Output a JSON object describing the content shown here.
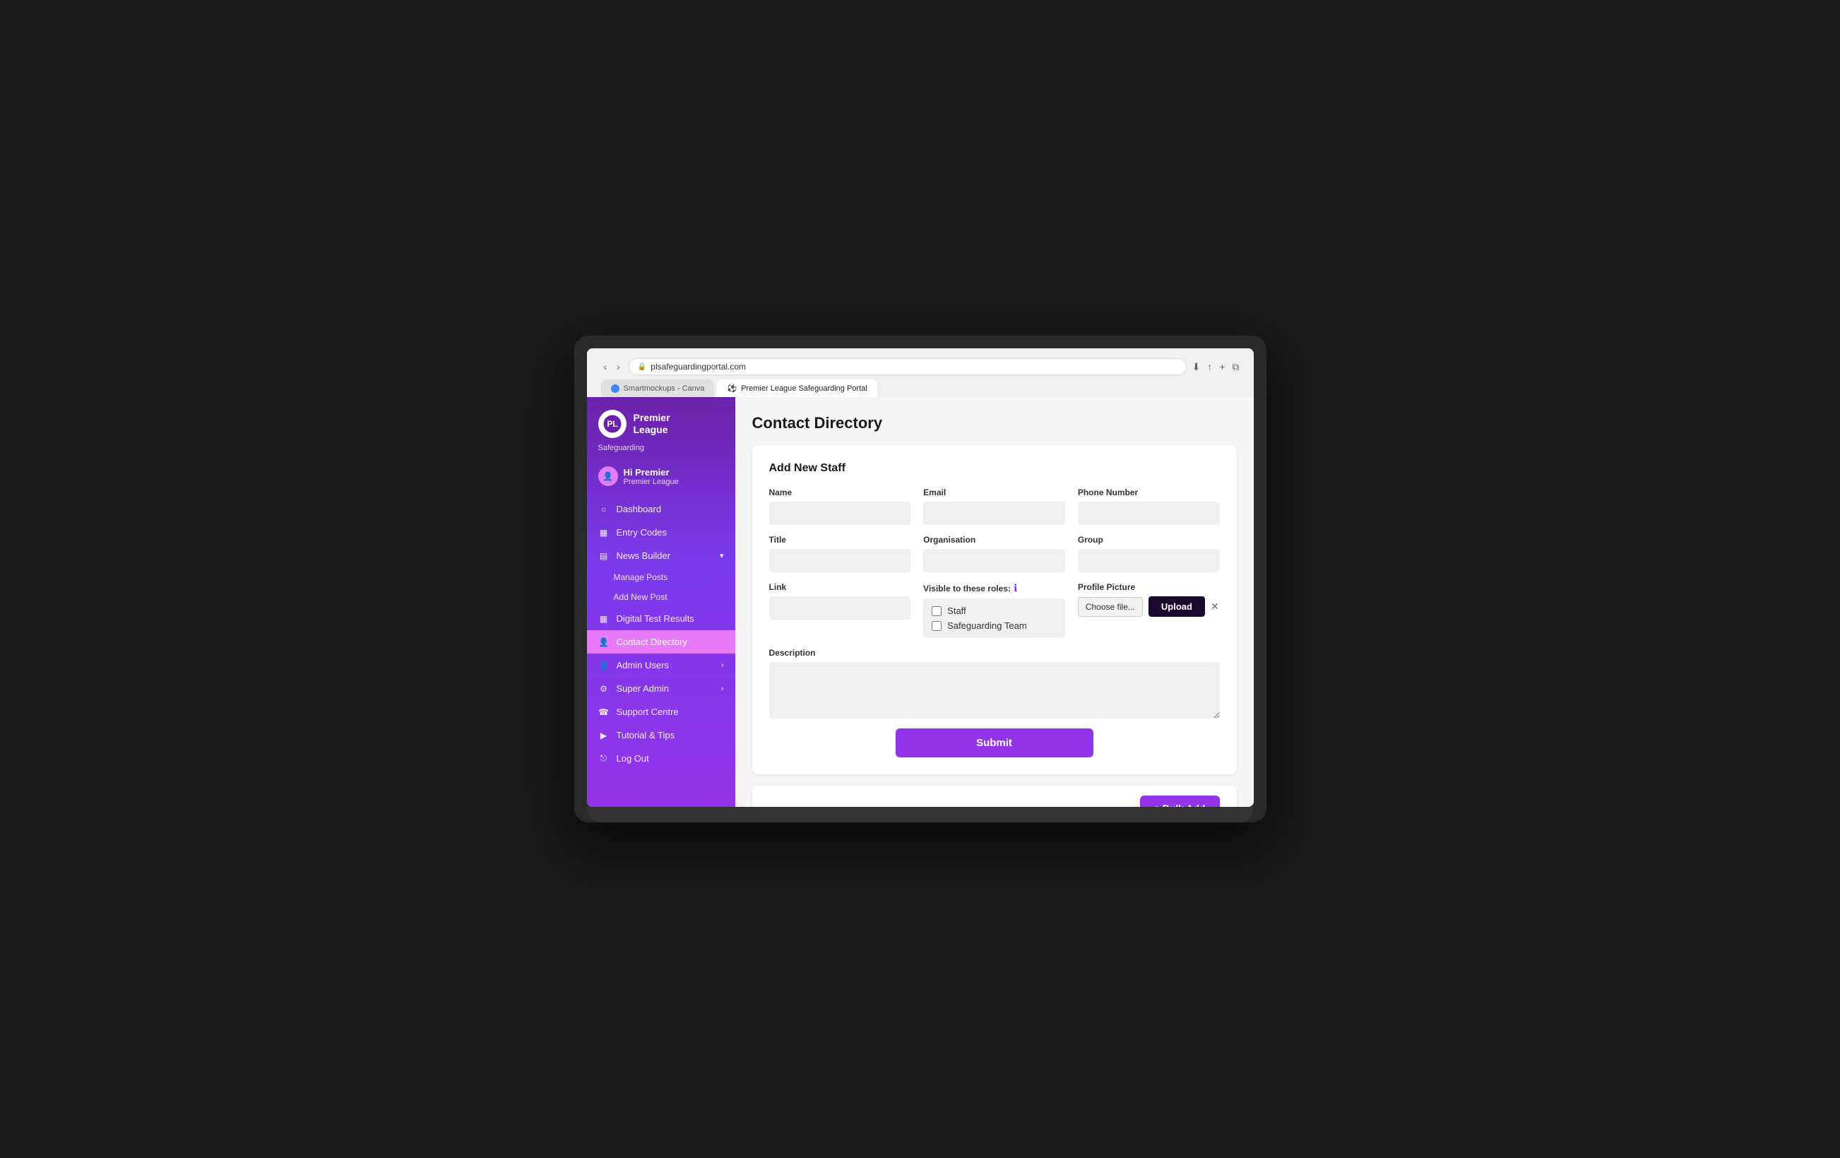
{
  "browser": {
    "url": "plsafeguardingportal.com",
    "tabs": [
      {
        "id": "tab1",
        "label": "Smartmockups - Canva",
        "active": false
      },
      {
        "id": "tab2",
        "label": "Premier League Safeguarding Portal",
        "active": true
      }
    ],
    "back_btn": "‹",
    "forward_btn": "›"
  },
  "sidebar": {
    "logo_text": "Premier\nLeague",
    "logo_sub": "Safeguarding",
    "user_greeting": "Hi Premier",
    "user_name": "Premier League",
    "nav_items": [
      {
        "id": "dashboard",
        "label": "Dashboard",
        "icon": "○",
        "active": false
      },
      {
        "id": "entry-codes",
        "label": "Entry Codes",
        "icon": "▦",
        "active": false
      },
      {
        "id": "news-builder",
        "label": "News Builder",
        "icon": "▤",
        "active": false,
        "has_arrow": true
      },
      {
        "id": "manage-posts",
        "label": "Manage Posts",
        "icon": "",
        "active": false,
        "sub": true
      },
      {
        "id": "add-new-post",
        "label": "Add New Post",
        "icon": "",
        "active": false,
        "sub": true
      },
      {
        "id": "digital-test",
        "label": "Digital Test Results",
        "icon": "▦",
        "active": false
      },
      {
        "id": "contact-directory",
        "label": "Contact Directory",
        "icon": "👤",
        "active": true
      },
      {
        "id": "admin-users",
        "label": "Admin Users",
        "icon": "👤",
        "active": false,
        "has_arrow": true
      },
      {
        "id": "super-admin",
        "label": "Super Admin",
        "icon": "⚙",
        "active": false,
        "has_arrow": true
      },
      {
        "id": "support-centre",
        "label": "Support Centre",
        "icon": "☎",
        "active": false
      },
      {
        "id": "tutorial-tips",
        "label": "Tutorial & Tips",
        "icon": "▶",
        "active": false
      },
      {
        "id": "log-out",
        "label": "Log Out",
        "icon": "⎋",
        "active": false
      }
    ]
  },
  "main": {
    "page_title": "Contact Directory",
    "form": {
      "title": "Add New Staff",
      "fields": {
        "name_label": "Name",
        "email_label": "Email",
        "phone_label": "Phone Number",
        "title_label": "Title",
        "organisation_label": "Organisation",
        "group_label": "Group",
        "link_label": "Link",
        "roles_label": "Visible to these roles:",
        "profile_picture_label": "Profile Picture",
        "description_label": "Description",
        "roles": [
          "Staff",
          "Safeguarding Team"
        ],
        "choose_file_label": "Choose file...",
        "upload_btn_label": "Upload",
        "submit_btn_label": "Submit"
      }
    },
    "bulk_add_btn": "+ Bulk Add"
  }
}
